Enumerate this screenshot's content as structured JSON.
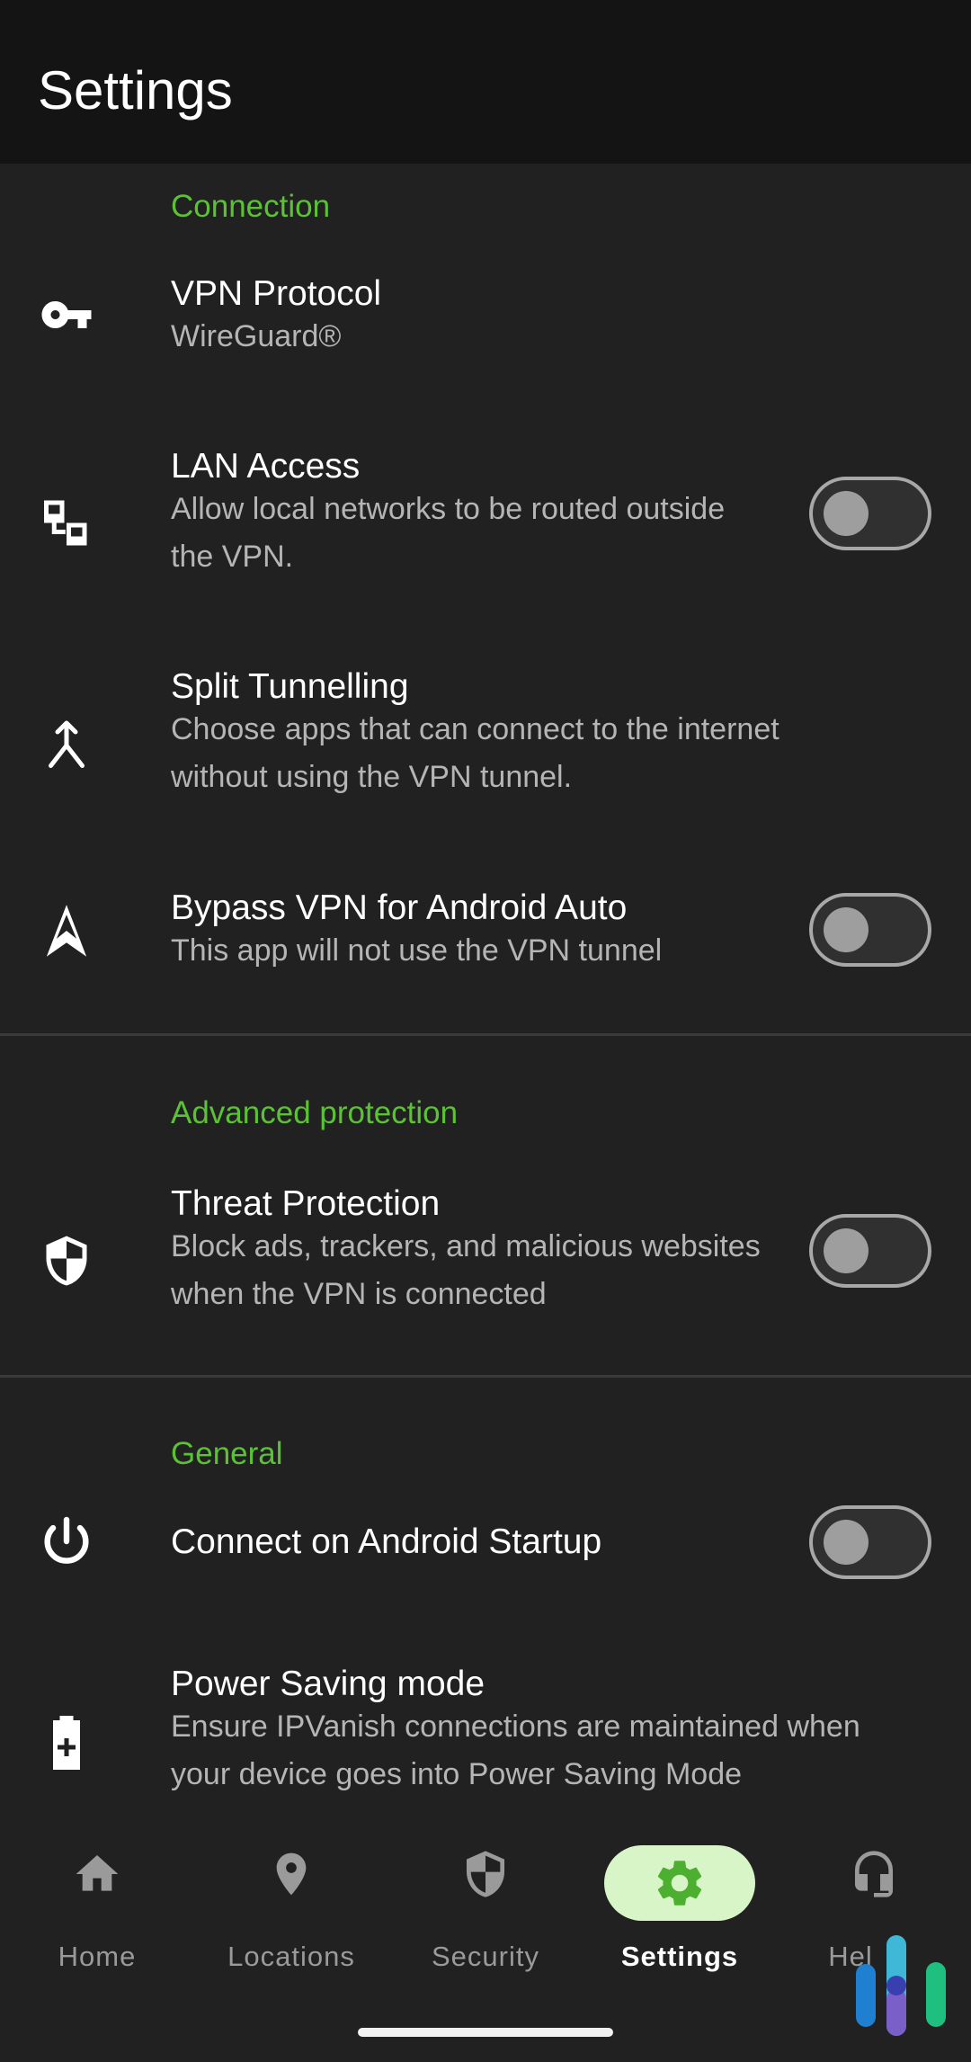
{
  "app": {
    "title": "Settings"
  },
  "sections": {
    "connection": "Connection",
    "advanced": "Advanced protection",
    "general": "General"
  },
  "rows": {
    "vpn_protocol": {
      "title": "VPN Protocol",
      "subtitle": "WireGuard®",
      "icon": "key-icon"
    },
    "lan_access": {
      "title": "LAN Access",
      "subtitle": "Allow local networks to be routed outside the VPN.",
      "icon": "lan-icon",
      "enabled": false
    },
    "split_tunnelling": {
      "title": "Split Tunnelling",
      "subtitle": "Choose apps that can connect to the internet without using the VPN tunnel.",
      "icon": "merge-icon"
    },
    "android_auto": {
      "title": "Bypass VPN for Android Auto",
      "subtitle": "This app will not use the VPN tunnel",
      "icon": "navigation-arrow-icon",
      "enabled": false
    },
    "threat_protection": {
      "title": "Threat Protection",
      "subtitle": "Block ads, trackers, and malicious websites when the VPN is connected",
      "icon": "shield-icon",
      "enabled": false
    },
    "startup": {
      "title": "Connect on Android Startup",
      "icon": "power-icon",
      "enabled": false
    },
    "power_saving": {
      "title": "Power Saving mode",
      "subtitle": "Ensure IPVanish connections are maintained when your device goes into Power Saving Mode",
      "icon": "battery-icon"
    }
  },
  "nav": {
    "home": "Home",
    "locations": "Locations",
    "security": "Security",
    "settings": "Settings",
    "help": "Hel"
  },
  "colors": {
    "accent": "#5bc236",
    "active_pill": "#d8f5c8",
    "background": "#212121",
    "appbar": "#141414"
  }
}
